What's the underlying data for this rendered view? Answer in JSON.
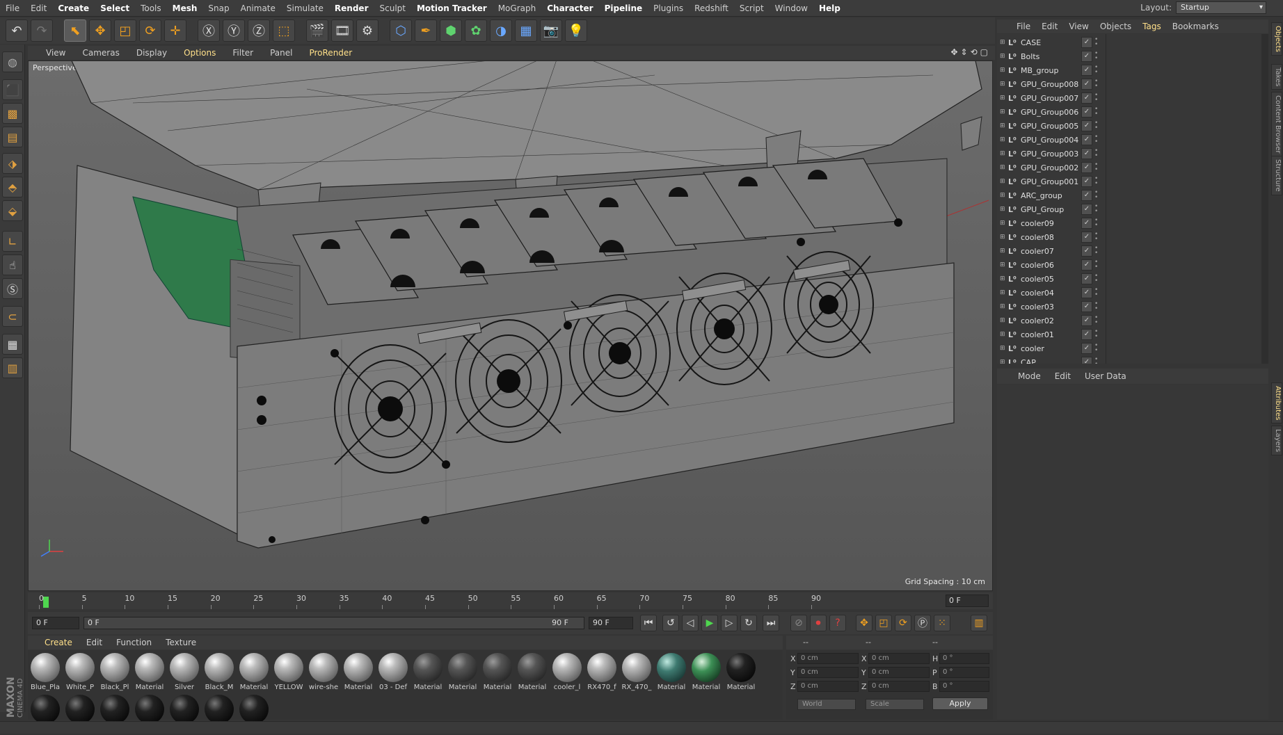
{
  "menubar": {
    "items": [
      "File",
      "Edit",
      "Create",
      "Select",
      "Tools",
      "Mesh",
      "Snap",
      "Animate",
      "Simulate",
      "Render",
      "Sculpt",
      "Motion Tracker",
      "MoGraph",
      "Character",
      "Pipeline",
      "Plugins",
      "Redshift",
      "Script",
      "Window",
      "Help"
    ],
    "highlighted": [
      "Create",
      "Select",
      "Mesh",
      "Render",
      "Motion Tracker",
      "Character",
      "Pipeline",
      "Help"
    ],
    "layout_label": "Layout:",
    "layout_value": "Startup"
  },
  "viewport": {
    "menu": [
      "View",
      "Cameras",
      "Display",
      "Options",
      "Filter",
      "Panel",
      "ProRender"
    ],
    "highlighted": [
      "Options",
      "ProRender"
    ],
    "label": "Perspective",
    "grid_spacing": "Grid Spacing : 10 cm"
  },
  "timeline": {
    "ticks": [
      "0",
      "5",
      "10",
      "15",
      "20",
      "25",
      "30",
      "35",
      "40",
      "45",
      "50",
      "55",
      "60",
      "65",
      "70",
      "75",
      "80",
      "85",
      "90"
    ],
    "current_frame": "0 F"
  },
  "transport": {
    "start_field": "0 F",
    "range_start": "0 F",
    "range_end": "90 F",
    "end_field": "90 F"
  },
  "material_manager": {
    "menu": [
      "Create",
      "Edit",
      "Function",
      "Texture"
    ],
    "highlighted": [
      "Create"
    ],
    "materials": [
      {
        "label": "Blue_Pla",
        "style": "ball"
      },
      {
        "label": "White_P",
        "style": "ball"
      },
      {
        "label": "Black_Pl",
        "style": "ball"
      },
      {
        "label": "Material",
        "style": "ball"
      },
      {
        "label": "Silver",
        "style": "ball"
      },
      {
        "label": "Black_M",
        "style": "ball"
      },
      {
        "label": "Material",
        "style": "ball"
      },
      {
        "label": "YELLOW",
        "style": "ball"
      },
      {
        "label": "wire-she",
        "style": "ball"
      },
      {
        "label": "Material",
        "style": "ball"
      },
      {
        "label": "03 - Def",
        "style": "ball"
      },
      {
        "label": "Material",
        "style": "dark"
      },
      {
        "label": "Material",
        "style": "dark"
      },
      {
        "label": "Material",
        "style": "dark"
      },
      {
        "label": "Material",
        "style": "dark"
      },
      {
        "label": "cooler_l",
        "style": "ball"
      },
      {
        "label": "RX470_f",
        "style": "ball"
      },
      {
        "label": "RX_470_",
        "style": "ball"
      },
      {
        "label": "Material",
        "style": "teal"
      },
      {
        "label": "Material",
        "style": "green"
      },
      {
        "label": "Material",
        "style": "black"
      }
    ],
    "second_row_count": 7
  },
  "coordinates": {
    "header_cols": [
      "--",
      "--",
      "--"
    ],
    "rows": [
      {
        "axis": "X",
        "pos": "0 cm",
        "axis2": "X",
        "size": "0 cm",
        "axis3": "H",
        "rot": "0 °"
      },
      {
        "axis": "Y",
        "pos": "0 cm",
        "axis2": "Y",
        "size": "0 cm",
        "axis3": "P",
        "rot": "0 °"
      },
      {
        "axis": "Z",
        "pos": "0 cm",
        "axis2": "Z",
        "size": "0 cm",
        "axis3": "B",
        "rot": "0 °"
      }
    ],
    "world": "World",
    "scale": "Scale",
    "apply": "Apply"
  },
  "object_manager": {
    "menu": [
      "File",
      "Edit",
      "View",
      "Objects",
      "Tags",
      "Bookmarks"
    ],
    "highlighted": [
      "Tags"
    ],
    "objects": [
      "CASE",
      "Bolts",
      "MB_group",
      "GPU_Group008",
      "GPU_Group007",
      "GPU_Group006",
      "GPU_Group005",
      "GPU_Group004",
      "GPU_Group003",
      "GPU_Group002",
      "GPU_Group001",
      "ARC_group",
      "GPU_Group",
      "cooler09",
      "cooler08",
      "cooler07",
      "cooler06",
      "cooler05",
      "cooler04",
      "cooler03",
      "cooler02",
      "cooler01",
      "cooler",
      "CAP"
    ]
  },
  "attributes": {
    "menu": [
      "Mode",
      "Edit",
      "User Data"
    ]
  },
  "right_tabs": [
    "Objects",
    "Takes",
    "Content Browser",
    "Structure",
    "Attributes",
    "Layers"
  ],
  "branding": {
    "maxon": "MAXON",
    "product": "CINEMA 4D"
  },
  "colors": {
    "accent_yellow": "#ffe08a",
    "playhead_green": "#4fd64f",
    "axis_x": "#e04040",
    "axis_y": "#4fd64f",
    "axis_z": "#4080ff"
  }
}
